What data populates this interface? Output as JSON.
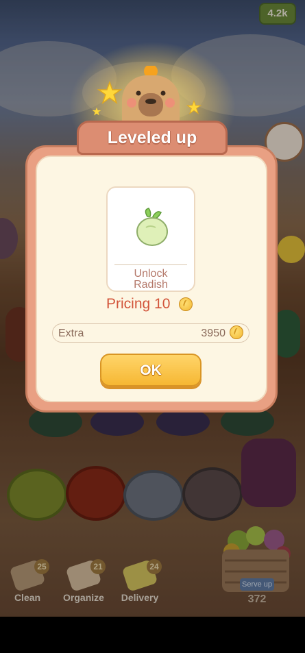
{
  "hud": {
    "coins": "4.2k"
  },
  "dialog": {
    "title": "Leveled up",
    "unlock_text_line1": "Unlock",
    "unlock_text_line2": "Radish",
    "pricing_label": "Pricing 10",
    "extra_label": "Extra",
    "extra_value": "3950",
    "ok_label": "OK"
  },
  "tools": [
    {
      "label": "Clean",
      "count": "25"
    },
    {
      "label": "Organize",
      "count": "21"
    },
    {
      "label": "Delivery",
      "count": "24"
    }
  ],
  "serve": {
    "button_label": "Serve up",
    "count": "372"
  },
  "colors": {
    "dialog_frame": "#e9a083",
    "dialog_panel": "#fdf6e3",
    "ok_button": "#f6b733",
    "title_text": "#ffffff",
    "pricing_text": "#d2543a"
  },
  "icons": [
    "radish-icon",
    "coin-icon",
    "capybara-mascot",
    "star-icon",
    "broom-icon",
    "glove-icon",
    "bag-icon",
    "vegetable-basket-icon"
  ]
}
